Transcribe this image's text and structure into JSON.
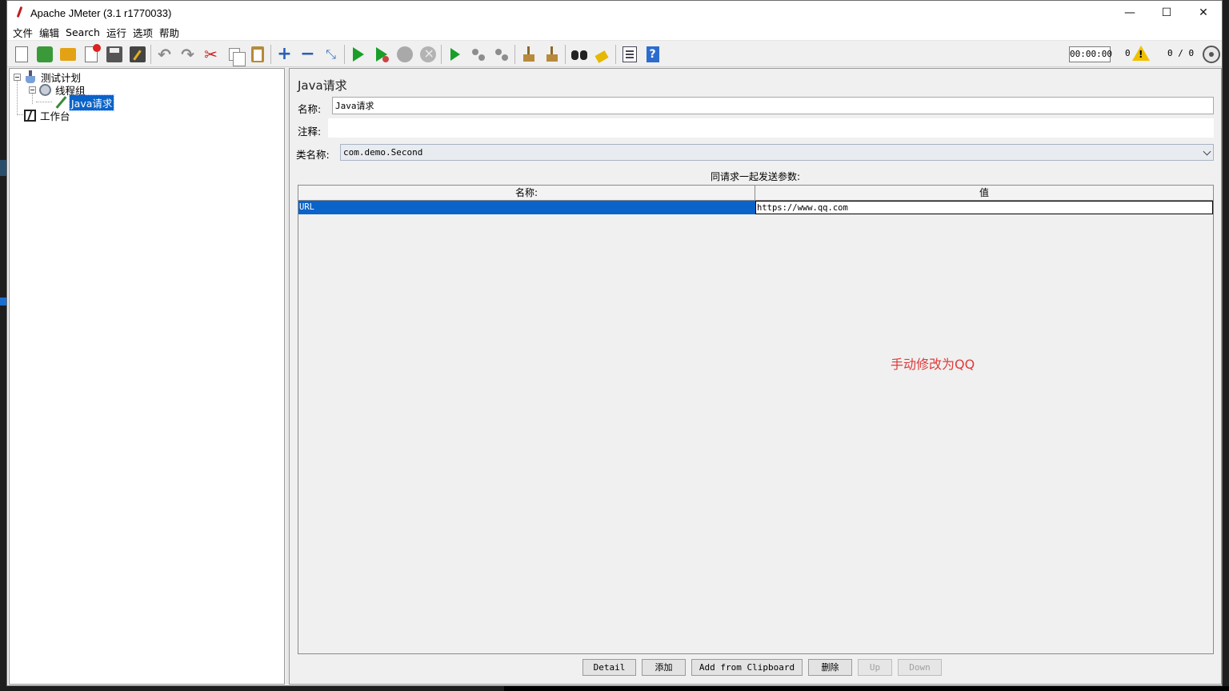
{
  "window": {
    "title": "Apache JMeter (3.1 r1770033)",
    "controls": {
      "minimize": "—",
      "maximize": "☐",
      "close": "✕"
    }
  },
  "menu": [
    "文件",
    "编辑",
    "Search",
    "运行",
    "选项",
    "帮助"
  ],
  "toolbar": {
    "icons": [
      "new-icon",
      "templates-icon",
      "open-icon",
      "close-icon",
      "save-icon",
      "save-as-icon",
      "undo-icon",
      "redo-icon",
      "cut-icon",
      "copy-icon",
      "paste-icon",
      "expand-icon",
      "collapse-icon",
      "toggle-icon",
      "start-icon",
      "start-no-pause-icon",
      "stop-icon",
      "shutdown-icon",
      "remote-start-icon",
      "remote-stop-icon",
      "remote-shutdown-icon",
      "clear-icon",
      "clear-all-icon",
      "search-icon",
      "reset-search-icon",
      "function-helper-icon",
      "help-icon"
    ],
    "timer": "00:00:00",
    "error_count": "0",
    "threads": "0 / 0"
  },
  "tree": {
    "nodes": [
      {
        "label": "测试计划",
        "icon": "test-plan-icon"
      },
      {
        "label": "线程组",
        "icon": "thread-group-icon"
      },
      {
        "label": "Java请求",
        "icon": "java-sampler-icon",
        "selected": true
      },
      {
        "label": "工作台",
        "icon": "workbench-icon"
      }
    ]
  },
  "panel": {
    "title": "Java请求",
    "name_label": "名称:",
    "name_value": "Java请求",
    "comment_label": "注释:",
    "comment_value": "",
    "classname_label": "类名称:",
    "classname_value": "com.demo.Second",
    "params_caption": "同请求一起发送参数:",
    "table": {
      "headers": [
        "名称:",
        "值"
      ],
      "rows": [
        {
          "name": "URL",
          "value": "https://www.qq.com"
        }
      ]
    },
    "annotation": "手动修改为QQ",
    "buttons": {
      "detail": "Detail",
      "add": "添加",
      "add_clipboard": "Add from Clipboard",
      "delete": "删除",
      "up": "Up",
      "down": "Down"
    }
  },
  "colors": {
    "selection": "#0a63c8",
    "annotation": "#e03a3a",
    "background": "#f0f0f0"
  }
}
